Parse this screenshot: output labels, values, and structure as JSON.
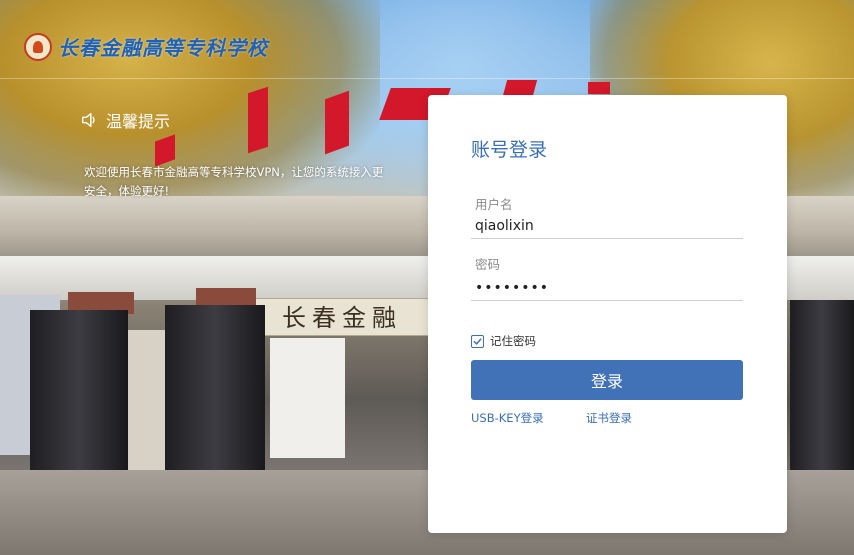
{
  "header": {
    "school_name": "长春金融高等专科学校",
    "links": [
      "",
      ""
    ]
  },
  "notice": {
    "title": "温馨提示",
    "text": "欢迎使用长春市金融高等专科学校VPN，让您的系统接入更安全，体验更好!"
  },
  "scene": {
    "gate_sign": "长春金融"
  },
  "login": {
    "title": "账号登录",
    "username_label": "用户名",
    "username_value": "qiaolixin",
    "password_label": "密码",
    "password_value": "••••••••",
    "remember_label": "记住密码",
    "remember_checked": true,
    "submit_label": "登录",
    "usbkey_label": "USB-KEY登录",
    "cert_label": "证书登录"
  },
  "colors": {
    "accent": "#4171b6",
    "title_blue": "#3a6fb7",
    "brand_blue": "#1f63b8",
    "card_bg": "#ffffff"
  }
}
